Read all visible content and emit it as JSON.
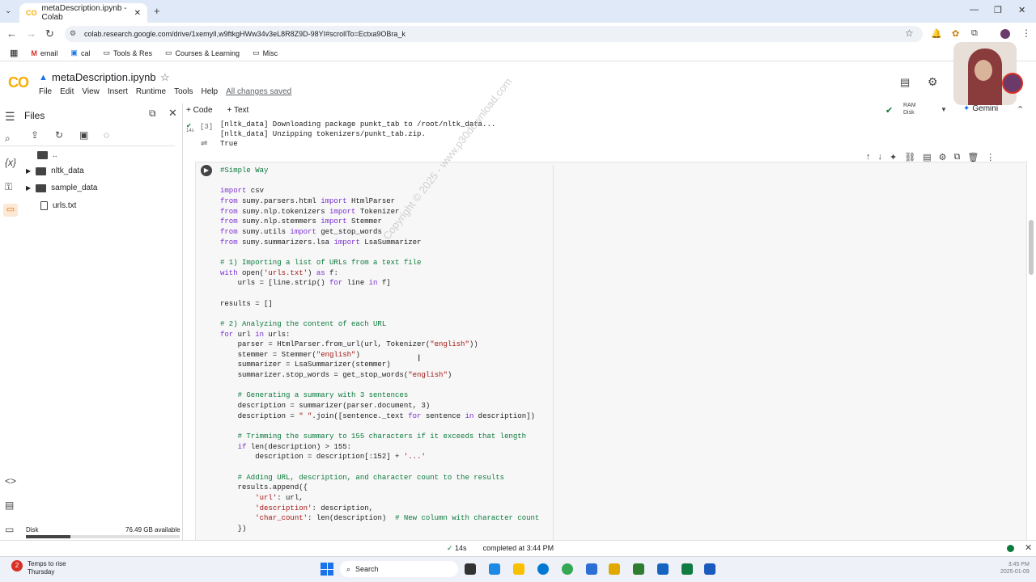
{
  "browser": {
    "tab_title": "metaDescription.ipynb - Colab",
    "url": "colab.research.google.com/drive/1xemylI,w9ftkgHWw34v3eL8R8Z9D-98YI#scrollTo=Ectxa9OBra_k"
  },
  "bookmarks": [
    "email",
    "cal",
    "Tools & Res",
    "Courses & Learning",
    "Misc"
  ],
  "colab": {
    "title": "metaDescription.ipynb",
    "menu": [
      "File",
      "Edit",
      "View",
      "Insert",
      "Runtime",
      "Tools",
      "Help"
    ],
    "saved": "All changes saved",
    "add_code": "+ Code",
    "add_text": "+ Text",
    "ram": "RAM",
    "disk": "Disk",
    "gemini": "Gemini"
  },
  "sidebar": {
    "title": "Files",
    "items": [
      "..",
      "nltk_data",
      "sample_data",
      "urls.txt"
    ],
    "disk_label": "Disk",
    "disk_avail": "76.49 GB available"
  },
  "output": {
    "exec": "[3]",
    "time": "14s",
    "lines": [
      "[nltk_data] Downloading package punkt_tab to /root/nltk_data...",
      "[nltk_data]   Unzipping tokenizers/punkt_tab.zip.",
      "True"
    ]
  },
  "watermark": "Copyright © 2025 - www.p30download.com",
  "status": {
    "time": "14s",
    "completed": "completed at 3:44 PM"
  },
  "taskbar": {
    "weather1": "Temps to rise",
    "weather2": "Thursday",
    "search": "Search",
    "clock": "3:45 PM",
    "date": "2025-01-09"
  }
}
